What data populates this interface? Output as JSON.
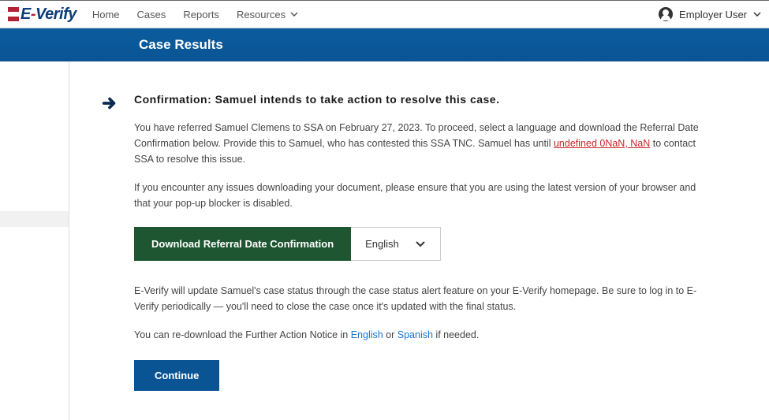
{
  "brand": {
    "e": "E",
    "dash": "-",
    "verify": "Verify"
  },
  "nav": {
    "home": "Home",
    "cases": "Cases",
    "reports": "Reports",
    "resources": "Resources"
  },
  "user": {
    "label": "Employer User"
  },
  "page_title": "Case Results",
  "confirmation": {
    "heading": "Confirmation: Samuel intends to take action to resolve this case.",
    "para1_a": "You have referred Samuel Clemens to SSA on February 27, 2023. To proceed, select a language and download the Referral Date Confirmation below. Provide this to Samuel, who has contested this SSA TNC. Samuel has until ",
    "deadline_text": "undefined 0NaN, NaN",
    "para1_b": " to contact SSA to resolve this issue.",
    "para2": "If you encounter any issues downloading your document, please ensure that you are using the latest version of your browser and that your pop-up blocker is disabled.",
    "download_label": "Download Referral Date Confirmation",
    "language_selected": "English",
    "para3": "E-Verify will update Samuel's case status through the case status alert feature on your E-Verify homepage. Be sure to log in to E-Verify periodically — you'll need to close the case once it's updated with the final status.",
    "para4_a": "You can re-download the Further Action Notice in ",
    "link_english": "English",
    "para4_or": " or ",
    "link_spanish": "Spanish",
    "para4_b": " if needed.",
    "continue_label": "Continue"
  }
}
